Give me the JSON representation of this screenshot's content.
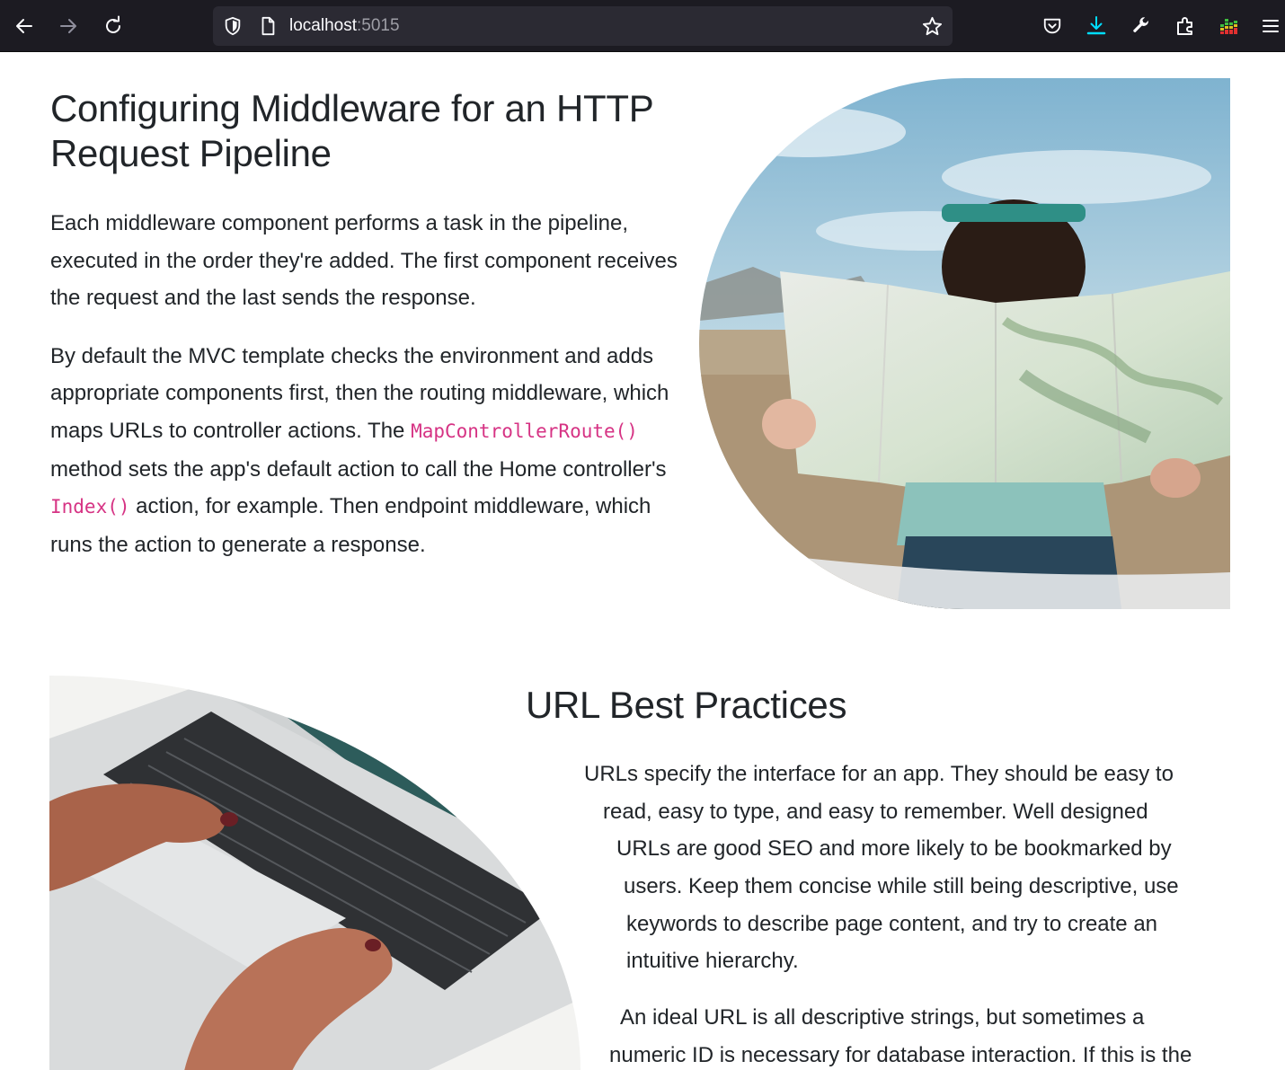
{
  "browser": {
    "url_host": "localhost",
    "url_port": ":5015",
    "icons": {
      "back": "back-arrow-icon",
      "forward": "forward-arrow-icon",
      "reload": "reload-icon",
      "shield": "tracking-protection-shield-icon",
      "page": "page-info-icon",
      "bookmark": "bookmark-star-icon",
      "pocket": "pocket-icon",
      "downloads": "downloads-icon",
      "tools": "wrench-icon",
      "extensions": "extensions-puzzle-icon",
      "equalizer": "equalizer-extension-icon",
      "menu": "hamburger-menu-icon"
    },
    "colors": {
      "toolbar": "#1c1b22",
      "urlbar": "#2b2a33",
      "download_accent": "#54ffbd"
    }
  },
  "section1": {
    "title": "Configuring Middleware for an HTTP Request Pipeline",
    "p1": "Each middleware component performs a task in the pipeline, executed in the order they're added. The first component receives the request and the last sends the response.",
    "p2_part1": "By default the MVC template checks the environment and adds appropriate components first, then the routing middleware, which maps URLs to controller actions. The ",
    "p2_code1": "MapControllerRoute()",
    "p2_part2": " method sets the app's default action to call the Home controller's ",
    "p2_code2": "Index()",
    "p2_part3": " action, for example. Then endpoint middleware, which runs the action to generate a response.",
    "image_subject": "woman-reading-map-photo"
  },
  "section2": {
    "title": "URL Best Practices",
    "image_subject": "hands-typing-on-laptop-photo",
    "p1_lines": [
      "URLs specify the interface for an app. They should be easy to",
      "read, easy to type, and easy to remember. Well designed",
      "URLs are good SEO and more likely to be bookmarked by",
      "users. Keep them concise while still being descriptive, use",
      "keywords to describe page content, and try to create an",
      "intuitive hierarchy."
    ],
    "p2_lines": [
      "An ideal URL is all descriptive strings, but sometimes a",
      "numeric ID is necessary for database interaction. If this is the"
    ]
  },
  "colors": {
    "text": "#212529",
    "code": "#d63384"
  }
}
